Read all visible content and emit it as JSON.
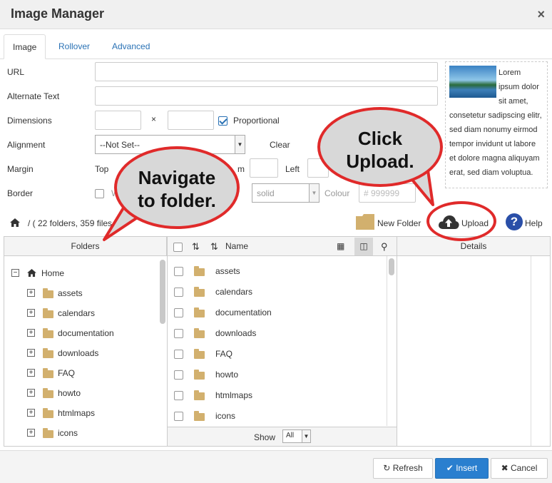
{
  "window": {
    "title": "Image Manager",
    "close_glyph": "×"
  },
  "tabs": [
    {
      "label": "Image"
    },
    {
      "label": "Rollover"
    },
    {
      "label": "Advanced"
    }
  ],
  "form": {
    "url_label": "URL",
    "alt_label": "Alternate Text",
    "dimensions_label": "Dimensions",
    "dim_separator": "×",
    "proportional_label": "Proportional",
    "alignment_label": "Alignment",
    "alignment_value": "--Not Set--",
    "clear_label": "Clear",
    "margin_label": "Margin",
    "margin_top_label": "Top",
    "margin_bottom_partial": "m",
    "margin_left_label": "Left",
    "border_label": "Border",
    "border_w_partial": "W",
    "border_style_value": "solid",
    "colour_label": "Colour",
    "colour_value": "# 999999"
  },
  "preview": {
    "text": "Lorem ipsum dolor sit amet, consetetur sadipscing elitr, sed diam nonumy eirmod tempor invidunt ut labore et dolore magna aliquyam erat, sed diam voluptua."
  },
  "toolbar": {
    "breadcrumb": "/ ( 22 folders, 359 files",
    "new_folder_label": "New Folder",
    "upload_label": "Upload",
    "help_label": "Help"
  },
  "panels": {
    "folders_header": "Folders",
    "name_header": "Name",
    "details_header": "Details",
    "show_label": "Show",
    "show_value": "All"
  },
  "tree": {
    "root": "Home",
    "items": [
      "assets",
      "calendars",
      "documentation",
      "downloads",
      "FAQ",
      "howto",
      "htmlmaps",
      "icons"
    ]
  },
  "files": {
    "items": [
      "assets",
      "calendars",
      "documentation",
      "downloads",
      "FAQ",
      "howto",
      "htmlmaps",
      "icons"
    ]
  },
  "footer": {
    "refresh_label": "Refresh",
    "insert_label": "Insert",
    "cancel_label": "Cancel"
  },
  "callouts": {
    "navigate": "Navigate to folder.",
    "click_upload": "Click Upload."
  },
  "colors": {
    "accent": "#2a72b5",
    "primary_button": "#2a7fcf",
    "callout_border": "#e02a2a",
    "folder": "#d2b06e"
  }
}
